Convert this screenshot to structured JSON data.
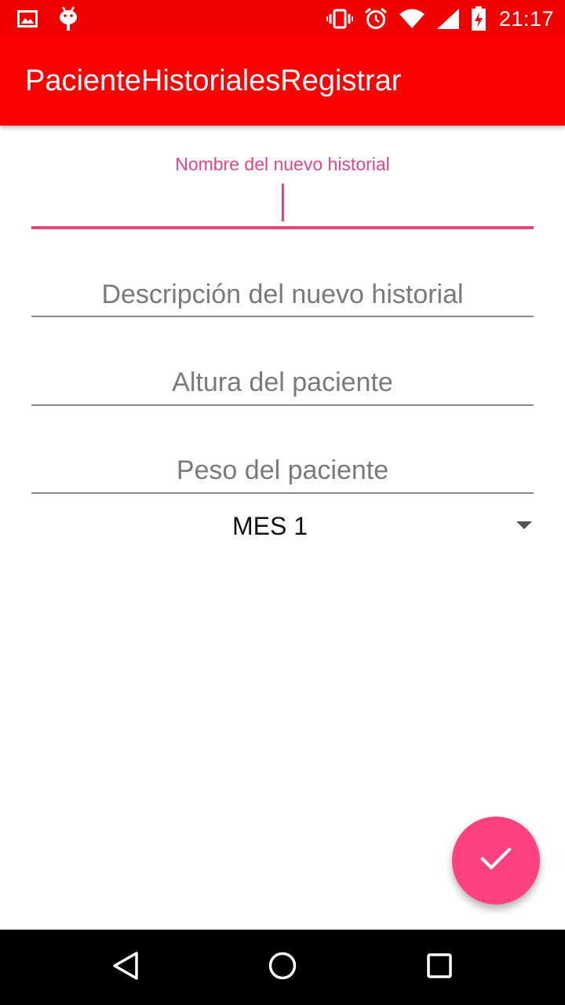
{
  "status_bar": {
    "time": "21:17",
    "left_icons": [
      "image-notification-icon",
      "android-debug-icon"
    ],
    "right_icons": [
      "vibrate-icon",
      "alarm-icon",
      "wifi-icon",
      "signal-icon",
      "battery-charging-icon"
    ]
  },
  "app_bar": {
    "title": "PacienteHistorialesRegistrar"
  },
  "form": {
    "name_field": {
      "label": "Nombre del nuevo historial",
      "value": ""
    },
    "description_field": {
      "placeholder": "Descripción del nuevo historial"
    },
    "height_field": {
      "placeholder": "Altura del paciente"
    },
    "weight_field": {
      "placeholder": "Peso del paciente"
    },
    "month_spinner": {
      "selected": "MES 1"
    }
  },
  "fab": {
    "icon": "check-icon"
  },
  "nav_bar": {
    "buttons": [
      "back-icon",
      "home-icon",
      "recents-icon"
    ]
  },
  "colors": {
    "status_bar": "#f20000",
    "app_bar": "#ff0000",
    "accent": "#ff4081",
    "focused_field": "#e7457f",
    "nav_bar": "#000000"
  }
}
